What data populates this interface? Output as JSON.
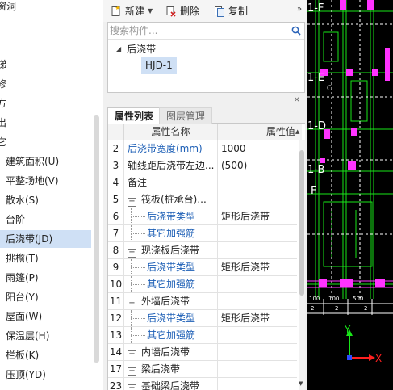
{
  "nav": {
    "items": [
      {
        "label": "窗洞"
      },
      {
        "label": "梯"
      },
      {
        "label": "修"
      },
      {
        "label": "方"
      },
      {
        "label": "出"
      },
      {
        "label": "它"
      },
      {
        "label": "建筑面积(U)"
      },
      {
        "label": "平整场地(V)"
      },
      {
        "label": "散水(S)"
      },
      {
        "label": "台阶"
      },
      {
        "label": "后浇带(JD)"
      },
      {
        "label": "挑檐(T)"
      },
      {
        "label": "雨篷(P)"
      },
      {
        "label": "阳台(Y)"
      },
      {
        "label": "屋面(W)"
      },
      {
        "label": "保温层(H)"
      },
      {
        "label": "栏板(K)"
      },
      {
        "label": "压顶(YD)"
      }
    ],
    "selected": "后浇带(JD)"
  },
  "toolbar": {
    "new_label": "新建",
    "delete_label": "删除",
    "copy_label": "复制",
    "more_label": "»"
  },
  "tree": {
    "search_placeholder": "搜索构件...",
    "root_label": "后浇带",
    "child_label": "HJD-1"
  },
  "props": {
    "close_label": "×",
    "tab_active": "属性列表",
    "tab_inactive": "图层管理",
    "col_name": "属性名称",
    "col_value": "属性值",
    "rows": [
      {
        "num": "2",
        "name": "后浇带宽度(mm)",
        "value": "1000"
      },
      {
        "num": "3",
        "name": "轴线距后浇带左边...",
        "value": "(500)"
      },
      {
        "num": "4",
        "name": "备注",
        "value": ""
      },
      {
        "num": "5",
        "name": "筏板(桩承台)...",
        "value": "",
        "toggle": "−"
      },
      {
        "num": "6",
        "name": "后浇带类型",
        "value": "矩形后浇带"
      },
      {
        "num": "7",
        "name": "其它加强筋",
        "value": ""
      },
      {
        "num": "8",
        "name": "现浇板后浇带",
        "value": "",
        "toggle": "−"
      },
      {
        "num": "9",
        "name": "后浇带类型",
        "value": "矩形后浇带"
      },
      {
        "num": "10",
        "name": "其它加强筋",
        "value": ""
      },
      {
        "num": "11",
        "name": "外墙后浇带",
        "value": "",
        "toggle": "−"
      },
      {
        "num": "12",
        "name": "后浇带类型",
        "value": "矩形后浇带"
      },
      {
        "num": "13",
        "name": "其它加强筋",
        "value": ""
      },
      {
        "num": "14",
        "name": "内墙后浇带",
        "value": "",
        "toggle": "+"
      },
      {
        "num": "17",
        "name": "梁后浇带",
        "value": "",
        "toggle": "+"
      },
      {
        "num": "23",
        "name": "基础梁后浇带",
        "value": "",
        "toggle": "+"
      }
    ]
  },
  "cad": {
    "labels": [
      "1-F",
      "1-E",
      "1-D",
      "1-B",
      "F",
      "C",
      "100",
      "100",
      "500",
      "2",
      "2",
      "2"
    ],
    "axis_x": "X",
    "axis_y": "Y",
    "colors": {
      "background": "#000000",
      "line_green": "#19e619",
      "line_magenta": "#ff33ff",
      "line_white": "#ffffff",
      "axis_red": "#ff2020"
    }
  }
}
